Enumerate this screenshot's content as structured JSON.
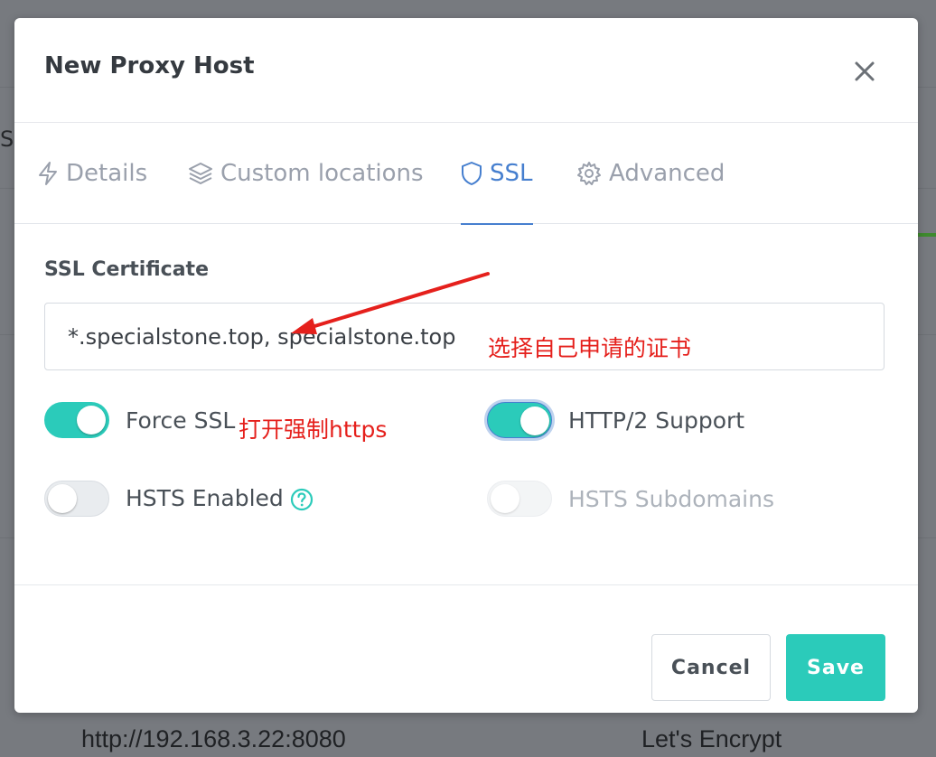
{
  "background": {
    "fragment": "SL",
    "row_address": "http://192.168.3.22:8080",
    "row_ssl": "Let's Encrypt"
  },
  "modal": {
    "title": "New Proxy Host",
    "close_icon": "close-icon"
  },
  "tabs": [
    {
      "label": "Details",
      "icon": "lightning-icon",
      "active": false
    },
    {
      "label": "Custom locations",
      "icon": "layers-icon",
      "active": false
    },
    {
      "label": "SSL",
      "icon": "shield-icon",
      "active": true
    },
    {
      "label": "Advanced",
      "icon": "gear-icon",
      "active": false
    }
  ],
  "ssl": {
    "certificate_label": "SSL Certificate",
    "certificate_value": "*.specialstone.top, specialstone.top",
    "toggles": {
      "force_ssl": {
        "label": "Force SSL",
        "on": true
      },
      "http2": {
        "label": "HTTP/2 Support",
        "on": true
      },
      "hsts": {
        "label": "HSTS Enabled",
        "on": false
      },
      "hsts_sub": {
        "label": "HSTS Subdomains",
        "on": false,
        "disabled": true
      }
    }
  },
  "annotations": {
    "cert_note": "选择自己申请的证书",
    "force_note": "打开强制https"
  },
  "footer": {
    "cancel_label": "Cancel",
    "save_label": "Save"
  },
  "colors": {
    "accent": "#2bcbba",
    "tab_active": "#467fcf",
    "annotation": "#e5201c"
  }
}
